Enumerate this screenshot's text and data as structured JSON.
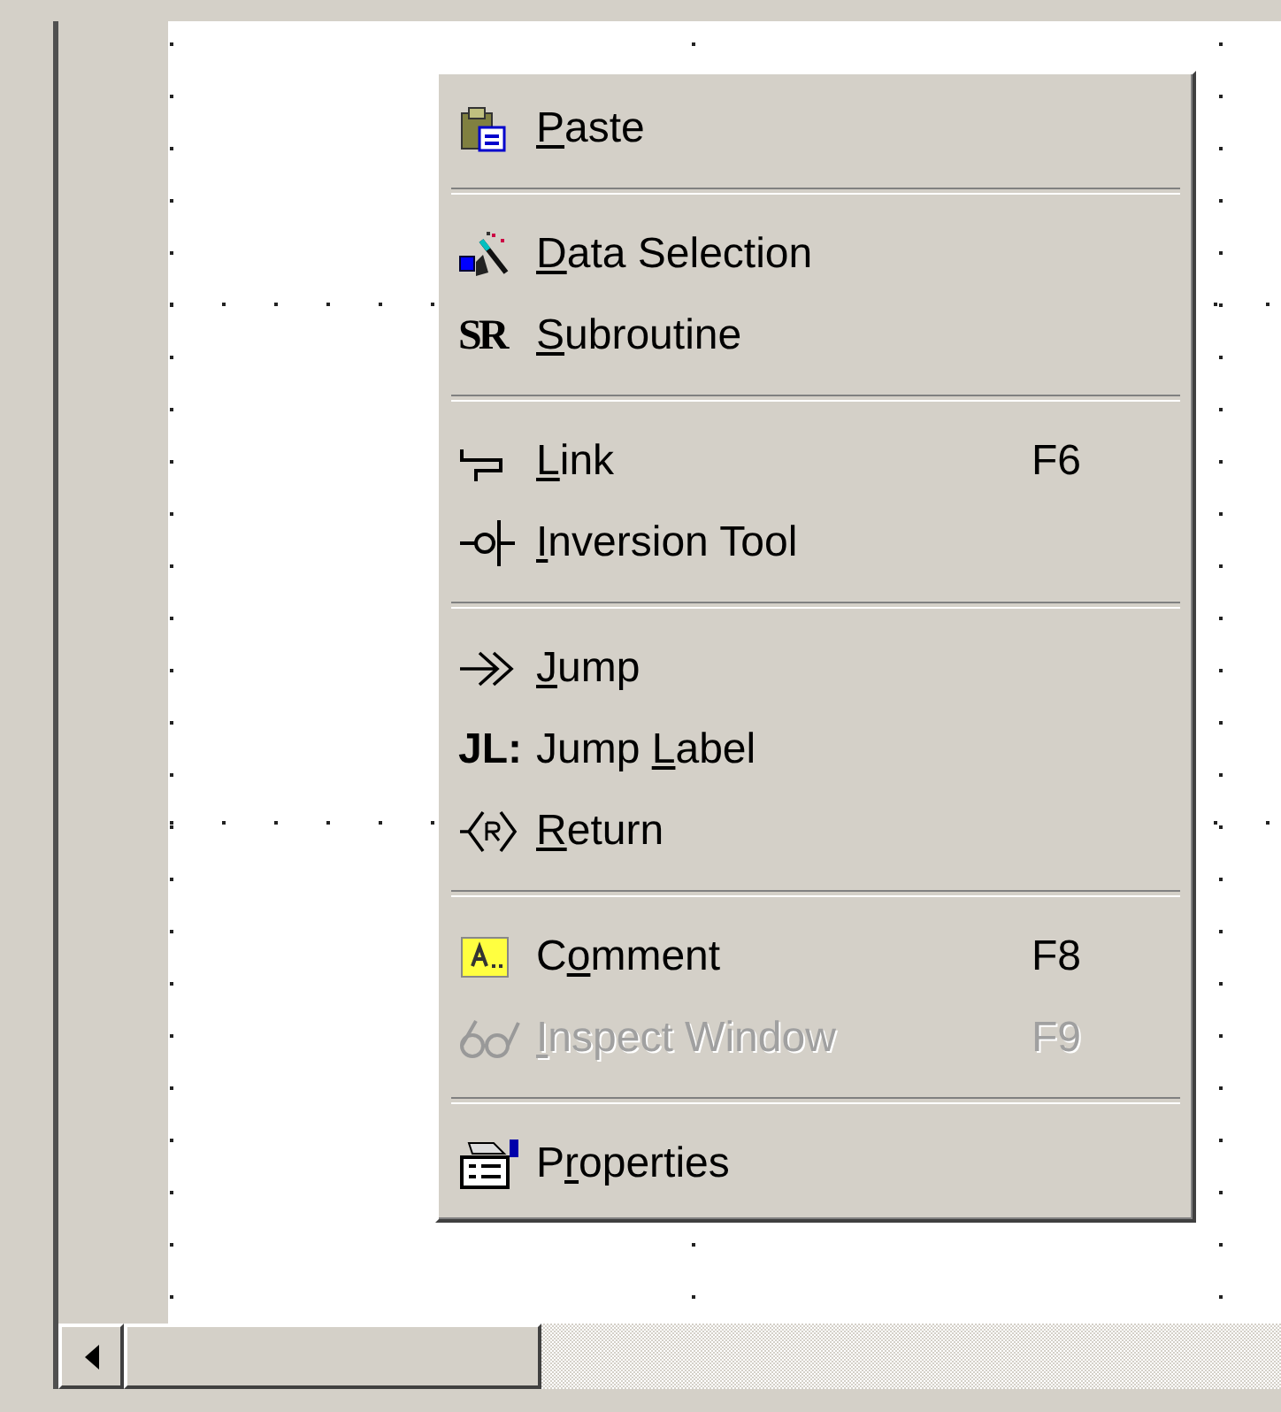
{
  "context_menu": {
    "groups": [
      [
        {
          "kind": "clipboard",
          "label": [
            {
              "text": "P",
              "underlined": true
            },
            {
              "text": "aste",
              "underlined": false
            }
          ],
          "disabled": false
        }
      ],
      [
        {
          "kind": "wand",
          "label": [
            {
              "text": "D",
              "underlined": true
            },
            {
              "text": "ata Selection",
              "underlined": false
            }
          ],
          "disabled": false
        },
        {
          "kind": "letters",
          "icon_text": "SR",
          "label": [
            {
              "text": "S",
              "underlined": true
            },
            {
              "text": "ubroutine",
              "underlined": false
            }
          ],
          "disabled": false
        }
      ],
      [
        {
          "kind": "link",
          "label": [
            {
              "text": "L",
              "underlined": true
            },
            {
              "text": "ink",
              "underlined": false
            }
          ],
          "shortcut": "F6",
          "disabled": false
        },
        {
          "kind": "inversion",
          "label": [
            {
              "text": "I",
              "underlined": true
            },
            {
              "text": "nversion Tool",
              "underlined": false
            }
          ],
          "disabled": false
        }
      ],
      [
        {
          "kind": "jump",
          "label": [
            {
              "text": "J",
              "underlined": true
            },
            {
              "text": "ump",
              "underlined": false
            }
          ],
          "disabled": false
        },
        {
          "kind": "label",
          "icon_text": "JL:",
          "label": [
            {
              "text": "Jump ",
              "underlined": false
            },
            {
              "text": "L",
              "underlined": true
            },
            {
              "text": "abel",
              "underlined": false
            }
          ],
          "disabled": false
        },
        {
          "kind": "return",
          "label": [
            {
              "text": "R",
              "underlined": true
            },
            {
              "text": "eturn",
              "underlined": false
            }
          ],
          "disabled": false
        }
      ],
      [
        {
          "kind": "comment",
          "label": [
            {
              "text": "C",
              "underlined": false
            },
            {
              "text": "o",
              "underlined": true
            },
            {
              "text": "mment",
              "underlined": false
            }
          ],
          "shortcut": "F8",
          "disabled": false
        },
        {
          "kind": "inspect",
          "label": [
            {
              "text": "I",
              "underlined": true
            },
            {
              "text": "nspect Window",
              "underlined": false
            }
          ],
          "shortcut": "F9",
          "disabled": true
        }
      ],
      [
        {
          "kind": "properties",
          "label": [
            {
              "text": "P",
              "underlined": false
            },
            {
              "text": "r",
              "underlined": true
            },
            {
              "text": "operties",
              "underlined": false
            }
          ],
          "disabled": false
        }
      ]
    ]
  }
}
